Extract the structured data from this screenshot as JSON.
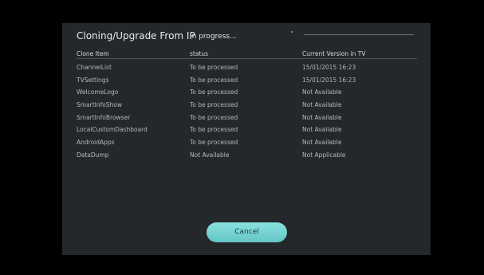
{
  "dialog": {
    "title": "Cloning/Upgrade From IP",
    "progress_text": "In progress...",
    "progress_fraction": 0.0
  },
  "table": {
    "columns": [
      "Clone Item",
      "status",
      "Current Version in TV"
    ],
    "rows": [
      [
        "ChannelList",
        "To be processed",
        "15/01/2015 16:23"
      ],
      [
        "TVSettings",
        "To be processed",
        "15/01/2015 16:23"
      ],
      [
        "WelcomeLogo",
        "To be processed",
        "Not Available"
      ],
      [
        "SmartInfoShow",
        "To be processed",
        "Not Available"
      ],
      [
        "SmartInfoBrowser",
        "To be processed",
        "Not Available"
      ],
      [
        "LocalCustomDashboard",
        "To be processed",
        "Not Available"
      ],
      [
        "AndroidApps",
        "To be processed",
        "Not Available"
      ],
      [
        "DataDump",
        "Not Available",
        "Not Applicable"
      ]
    ]
  },
  "buttons": {
    "cancel_label": "Cancel"
  },
  "colors": {
    "background": "#000000",
    "dialog": "#24282b",
    "accent": "#7dd8d6"
  }
}
